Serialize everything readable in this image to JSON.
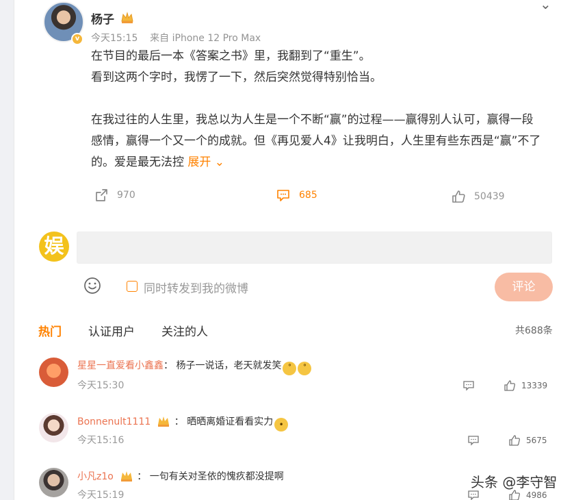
{
  "post": {
    "author": "杨子",
    "time": "今天15:15",
    "source": "来自 iPhone 12 Pro Max",
    "lines": [
      "在节目的最后一本《答案之书》里，我翻到了“重生”。",
      "看到这两个字时，我愣了一下，然后突然觉得特别恰当。",
      "在我过往的人生里，我总以为人生是一个不断“赢”的过程——赢得别人认可，赢得一段",
      "感情，赢得一个又一个的成就。但《再见爱人4》让我明白，人生里有些东西是“赢”不了",
      "的。爱是最无法控"
    ],
    "expand_label": "展开",
    "actions": {
      "reposts": "970",
      "comments": "685",
      "likes": "50439"
    }
  },
  "composer": {
    "logo_text": "娱",
    "repost_label": "同时转发到我的微博",
    "submit_label": "评论"
  },
  "tabs": [
    "热门",
    "认证用户",
    "关注的人"
  ],
  "total_comments": "共688条",
  "comments": [
    {
      "name": "星星一直爱看小鑫鑫",
      "text": "杨子一说话，老天就发笑",
      "time": "今天15:30",
      "likes": "13339"
    },
    {
      "name": "Bonnenult1111",
      "text": "晒晒离婚证看看实力",
      "time": "今天15:16",
      "likes": "5675"
    },
    {
      "name": "小凡z1o",
      "text": "一句有关对圣依的愧疚都没提啊",
      "time": "今天15:19",
      "likes": "4986"
    }
  ],
  "watermark": "头条 @李守智",
  "colors": {
    "accent": "#ff8200",
    "name": "#eb7350",
    "crown": "#f5b73b"
  }
}
